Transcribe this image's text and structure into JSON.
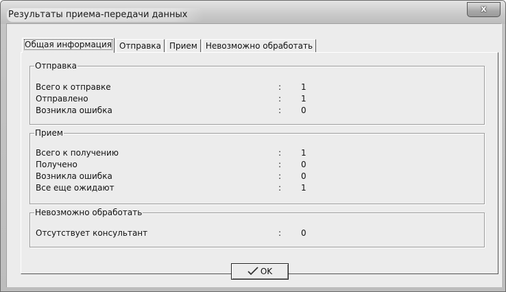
{
  "window": {
    "title": "Результаты приема-передачи данных",
    "close_glyph": "x"
  },
  "tabs": [
    {
      "label": "Общая информация",
      "active": true
    },
    {
      "label": "Отправка",
      "active": false
    },
    {
      "label": "Прием",
      "active": false
    },
    {
      "label": "Невозможно обработать",
      "active": false
    }
  ],
  "groups": {
    "send": {
      "title": "Отправка",
      "rows": [
        {
          "label": "Всего к отправке",
          "sep": ":",
          "value": "1"
        },
        {
          "label": "Отправлено",
          "sep": ":",
          "value": "1"
        },
        {
          "label": "Возникла ошибка",
          "sep": ":",
          "value": "0"
        }
      ]
    },
    "receive": {
      "title": "Прием",
      "rows": [
        {
          "label": "Всего к получению",
          "sep": ":",
          "value": "1"
        },
        {
          "label": "Получено",
          "sep": ":",
          "value": "0"
        },
        {
          "label": "Возникла ошибка",
          "sep": ":",
          "value": "0"
        },
        {
          "label": "Все еще ожидают",
          "sep": ":",
          "value": "1"
        }
      ]
    },
    "unprocessable": {
      "title": "Невозможно обработать",
      "rows": [
        {
          "label": "Отсутствует консультант",
          "sep": ":",
          "value": "0"
        }
      ]
    }
  },
  "ok_button": {
    "label": "OK",
    "icon": "checkmark-icon"
  }
}
